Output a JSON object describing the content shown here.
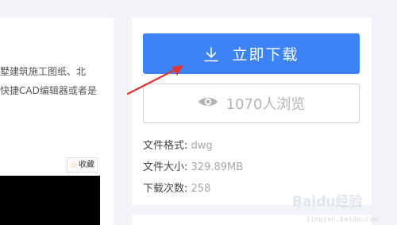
{
  "left": {
    "desc_line_1": "墅建筑施工图纸、北",
    "desc_line_2": "快捷CAD编辑器或者是",
    "favorite_label": "收藏"
  },
  "download": {
    "button_label": "立即下载",
    "views_label": "1070人浏览",
    "meta": [
      {
        "key": "文件格式:",
        "value": "dwg"
      },
      {
        "key": "文件大小:",
        "value": "329.89MB"
      },
      {
        "key": "下载次数:",
        "value": "258"
      }
    ]
  },
  "watermark": {
    "text": "Baidu经验",
    "sub": "jingyan.baidu.com"
  },
  "colors": {
    "primary": "#3d83f5",
    "annotation": "#e03434",
    "background": "#f1f3f6"
  }
}
